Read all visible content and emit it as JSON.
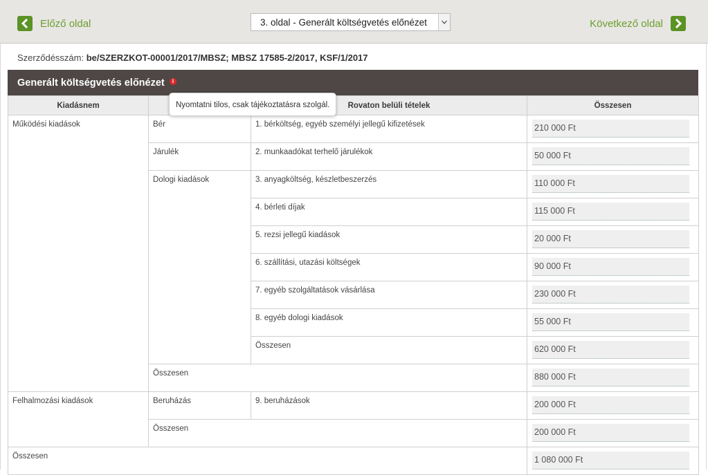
{
  "nav": {
    "prev_label": "Előző oldal",
    "next_label": "Következő oldal",
    "page_select_value": "3. oldal - Generált költségvetés előnézet"
  },
  "contract": {
    "label": "Szerződésszám:",
    "value": "be/SZERZKOT-00001/2017/MBSZ; MBSZ 17585-2/2017, KSF/1/2017"
  },
  "panel": {
    "title": "Generált költségvetés előnézet",
    "info_icon": "i",
    "tooltip": "Nyomtatni tilos, csak tájékoztatásra szolgál."
  },
  "table": {
    "headers": [
      "Kiadásnem",
      "",
      "Rovaton belüli tételek",
      "Összesen"
    ],
    "groups": [
      {
        "name": "Működési kiadások",
        "subgroups": [
          {
            "name": "Bér",
            "items": [
              {
                "label": "1. bérköltség, egyéb személyi jellegű kifizetések",
                "amount": "210 000 Ft"
              }
            ]
          },
          {
            "name": "Járulék",
            "items": [
              {
                "label": "2. munkaadókat terhelő járulékok",
                "amount": "50 000 Ft"
              }
            ]
          },
          {
            "name": "Dologi kiadások",
            "items": [
              {
                "label": "3. anyagköltség, készletbeszerzés",
                "amount": "110 000 Ft"
              },
              {
                "label": "4. bérleti díjak",
                "amount": "115 000 Ft"
              },
              {
                "label": "5. rezsi jellegű kiadások",
                "amount": "20 000 Ft"
              },
              {
                "label": "6. szállítási, utazási költségek",
                "amount": "90 000 Ft"
              },
              {
                "label": "7. egyéb szolgáltatások vásárlása",
                "amount": "230 000 Ft"
              },
              {
                "label": "8. egyéb dologi kiadások",
                "amount": "55 000 Ft"
              },
              {
                "label": "Összesen",
                "amount": "620 000 Ft"
              }
            ]
          }
        ],
        "total_label": "Összesen",
        "total": "880 000 Ft"
      },
      {
        "name": "Felhalmozási kiadások",
        "subgroups": [
          {
            "name": "Beruházás",
            "items": [
              {
                "label": "9. beruházások",
                "amount": "200 000 Ft"
              }
            ]
          }
        ],
        "total_label": "Összesen",
        "total": "200 000 Ft"
      }
    ],
    "grand_total_label": "Összesen",
    "grand_total": "1 080 000 Ft"
  },
  "colors": {
    "accent_green": "#5b9325",
    "panel_header": "#4e4745",
    "info_red": "#d92b2b"
  }
}
